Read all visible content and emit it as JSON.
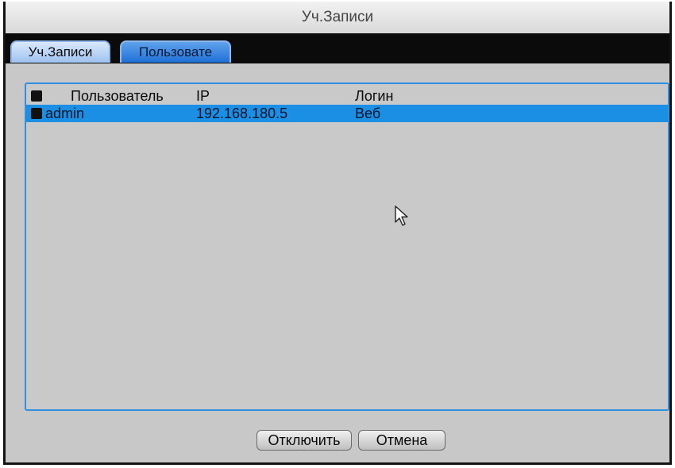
{
  "window": {
    "title": "Уч.Записи"
  },
  "tabs": [
    {
      "label": "Уч.Записи"
    },
    {
      "label": "Пользовате"
    }
  ],
  "table": {
    "headers": {
      "user": "Пользователь",
      "ip": "IP",
      "login": "Логин"
    },
    "rows": [
      {
        "user": "admin",
        "ip": "192.168.180.5",
        "login": "Веб"
      }
    ]
  },
  "buttons": {
    "disconnect": "Отключить",
    "cancel": "Отмена"
  },
  "colors": {
    "selection": "#1b8fe3",
    "accent_border": "#2f8fe0",
    "tab_active": "#1e6fd6"
  }
}
